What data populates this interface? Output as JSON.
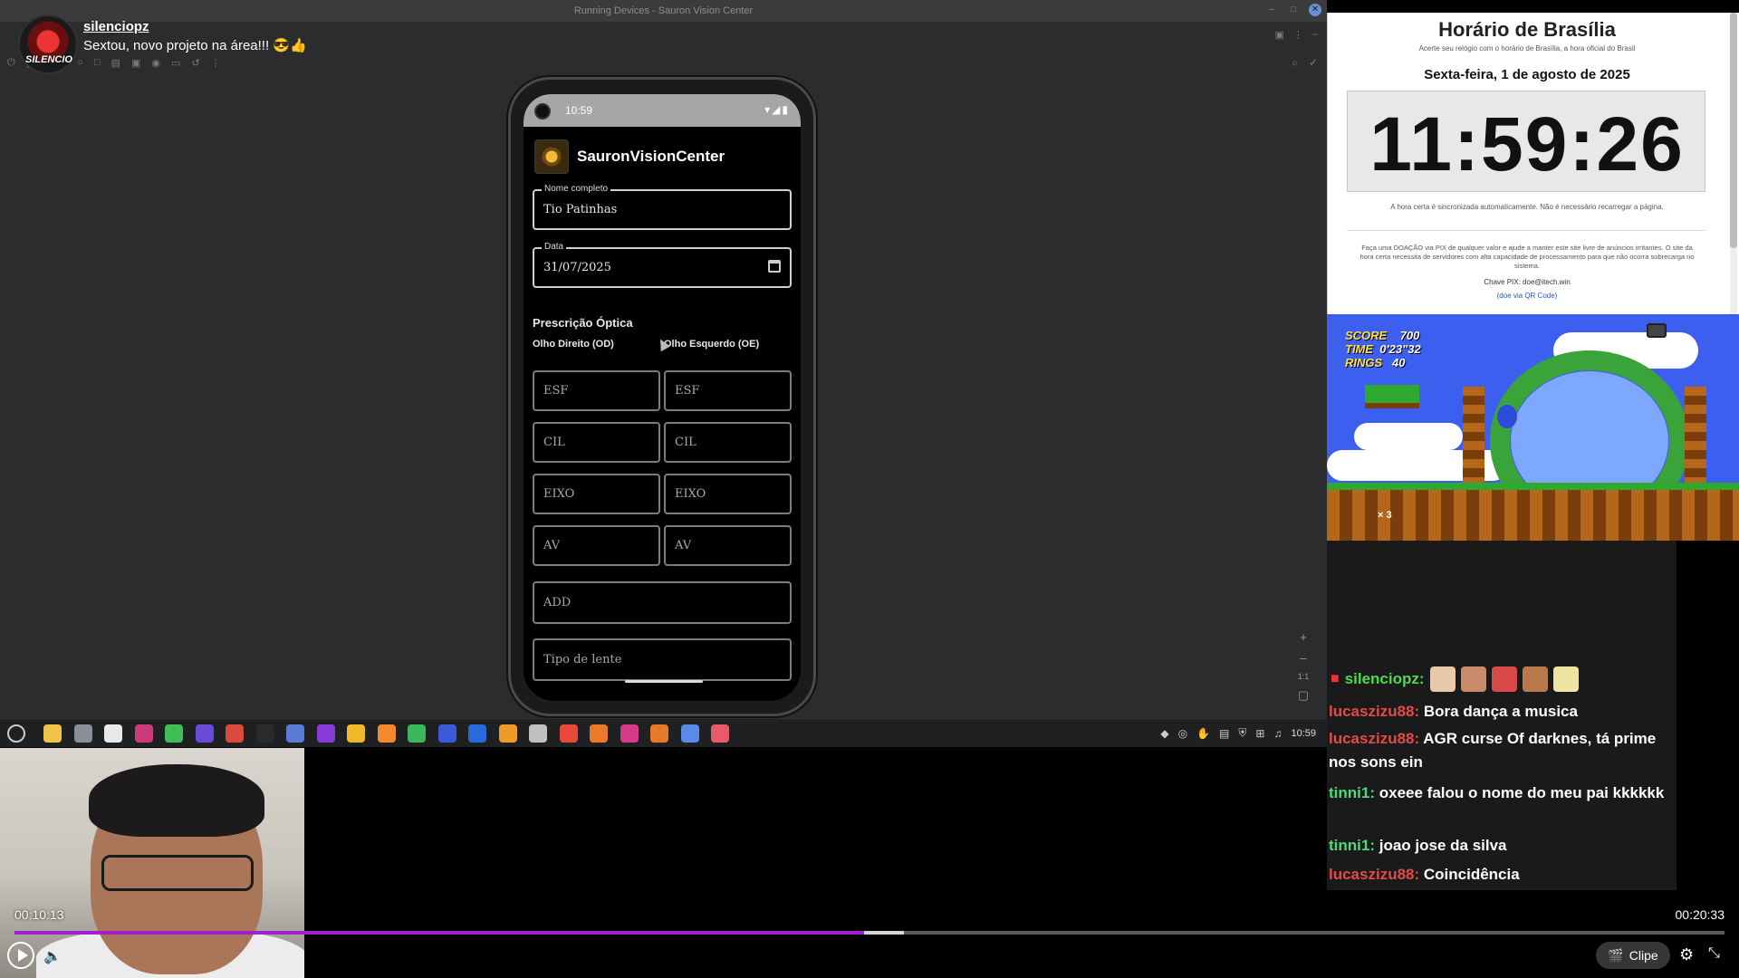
{
  "window": {
    "title": "Running Devices - Sauron Vision Center"
  },
  "stream": {
    "streamer_name": "silenciopz",
    "title": "Sextou, novo projeto na área!!! 😎👍",
    "avatar_label": "SILENCIO"
  },
  "phone": {
    "status_time": "10:59",
    "status_icons": "▾◢▮",
    "app_title": "SauronVisionCenter",
    "name_field": {
      "legend": "Nome completo",
      "value": "Tio Patinhas"
    },
    "date_field": {
      "legend": "Data",
      "value": "31/07/2025"
    },
    "section_title": "Prescrição Óptica",
    "left_column_label": "Olho Direito (OD)",
    "right_column_label": "Olho Esquerdo (OE)",
    "rows": [
      {
        "od": "ESF",
        "oe": "ESF"
      },
      {
        "od": "CIL",
        "oe": "CIL"
      },
      {
        "od": "EIXO",
        "oe": "EIXO"
      },
      {
        "od": "AV",
        "oe": "AV"
      }
    ],
    "add_placeholder": "ADD",
    "lens_type_placeholder": "Tipo de lente"
  },
  "emulator_zoom": {
    "plus": "+",
    "minus": "–",
    "one_to_one": "1:1",
    "fit": "▢"
  },
  "taskbar": {
    "icon_colors": [
      "#f0c24a",
      "#8a8f98",
      "#e8e8e8",
      "#c83a7a",
      "#3fbf5a",
      "#6a4bd8",
      "#d94a3a",
      "#2a2a2a",
      "#5a7bd8",
      "#8a3ad8",
      "#f0b92a",
      "#f08a2a",
      "#3ab85a",
      "#3a5ad8",
      "#2a6ad8",
      "#f09a2a",
      "#c0c0c0",
      "#e84a3a",
      "#e87a2a",
      "#d83a8a",
      "#e8782a",
      "#5a8ae8",
      "#e85a6a"
    ],
    "tray_clock": "10:59"
  },
  "clock_site": {
    "title": "Horário de Brasília",
    "subtitle": "Acerte seu relógio com o horário de Brasília, a hora oficial do Brasil",
    "date": "Sexta-feira, 1 de agosto de 2025",
    "time": "11:59:26",
    "note": "A hora certa é sincronizada automaticamente. Não é necessário recarregar a página.",
    "donation": "Faça uma DOAÇÃO via PIX de qualquer valor e ajude a manter este site livre de anúncios irritantes. O site da hora certa necessita de servidores com alta capacidade de processamento para que não ocorra sobrecarga no sistema.",
    "pix": "Chave PIX: doe@itech.win",
    "qr_link": "(doe via QR Code)"
  },
  "game": {
    "score_label": "SCORE",
    "score_value": "700",
    "time_label": "TIME",
    "time_value": "0'23\"32",
    "rings_label": "RINGS",
    "rings_value": "40",
    "lives": "× 3"
  },
  "chat": {
    "header_user": "silenciopz:",
    "messages": [
      {
        "user": "lucaszizu88:",
        "text": "Bora dança a musica",
        "color": "red"
      },
      {
        "user": "lucaszizu88:",
        "text": "AGR curse Of darknes, tá prime nos sons ein",
        "color": "red"
      },
      {
        "user": "tinni1:",
        "text": "oxeee falou o nome do meu pai kkkkkk",
        "color": "green"
      },
      {
        "user": "tinni1:",
        "text": "joao jose da silva",
        "color": "green"
      },
      {
        "user": "lucaszizu88:",
        "text": "Coincidência",
        "color": "red"
      }
    ]
  },
  "player": {
    "current_time": "00:10:13",
    "total_time": "00:20:33",
    "progress_fraction": 0.497,
    "buffered_fraction": 0.52,
    "clip_label": "Clipe",
    "accent_color": "#a020d0"
  }
}
